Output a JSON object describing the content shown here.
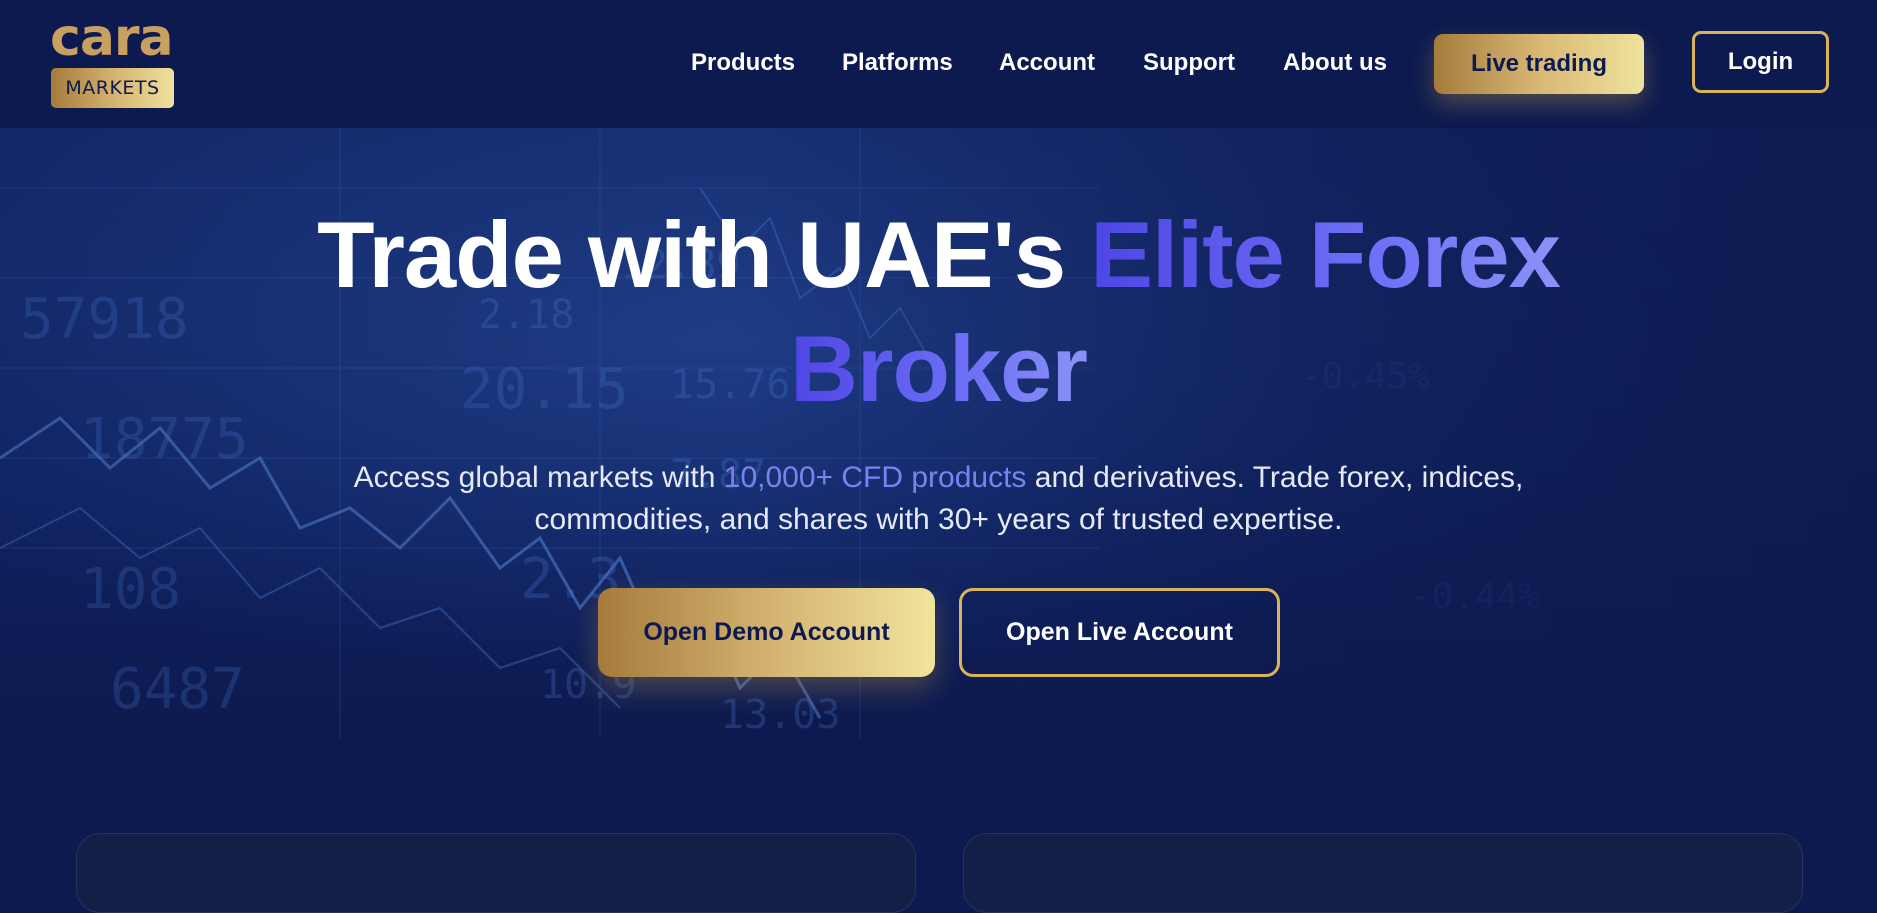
{
  "brand": {
    "logo_word": "cara",
    "logo_badge": "MARKETS",
    "accent_gold": "#d7b45a",
    "accent_indigo": "#6366f1",
    "background": "#0d1a4f"
  },
  "nav": {
    "items": [
      {
        "label": "Products"
      },
      {
        "label": "Platforms"
      },
      {
        "label": "Account"
      },
      {
        "label": "Support"
      },
      {
        "label": "About us"
      }
    ],
    "live_trading_label": "Live trading",
    "login_label": "Login"
  },
  "hero": {
    "headline_plain": "Trade with UAE's",
    "headline_accent_1": "Elite Forex",
    "headline_accent_2": "Broker",
    "sub_part1": "Access global markets with",
    "sub_highlight": "10,000+ CFD products",
    "sub_part2": "and derivatives. Trade forex, indices,",
    "sub_line2": "commodities, and shares with 30+ years of trusted expertise.",
    "demo_button": "Open Demo Account",
    "live_button": "Open Live Account"
  }
}
